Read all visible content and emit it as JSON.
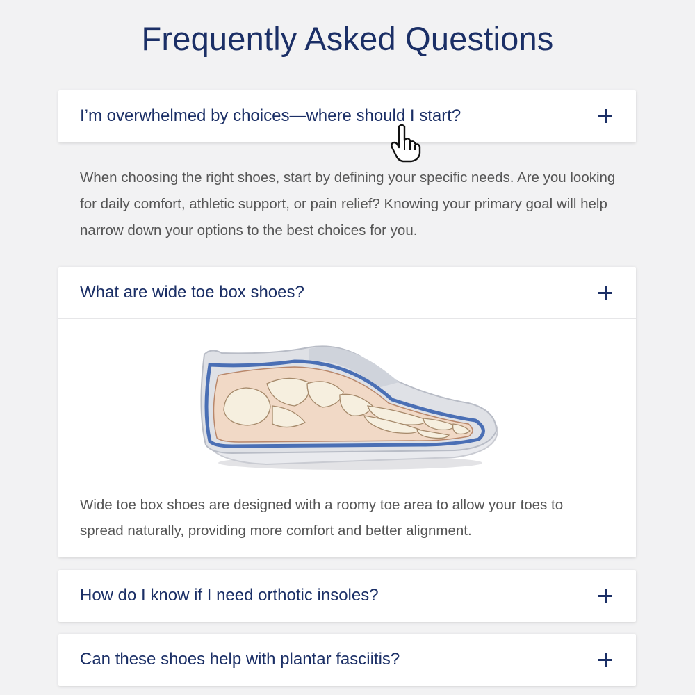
{
  "page": {
    "title": "Frequently Asked Questions"
  },
  "faq": [
    {
      "question": "I’m overwhelmed by choices—where should I start?",
      "answer": "When choosing the right shoes, start by defining your specific needs. Are you looking for daily comfort, athletic support, or pain relief? Knowing your primary goal will help narrow down your options to the best choices for you.",
      "toggle_icon": "plus-icon"
    },
    {
      "question": "What are wide toe box shoes?",
      "answer": "Wide toe box shoes are designed with a roomy toe area to allow your toes to spread naturally, providing more comfort and better alignment.",
      "image": "shoe-foot-skeleton-illustration",
      "toggle_icon": "plus-icon"
    },
    {
      "question": "How do I know if I need orthotic insoles?",
      "toggle_icon": "plus-icon"
    },
    {
      "question": "Can these shoes help with plantar fasciitis?",
      "toggle_icon": "plus-icon"
    }
  ],
  "cursor": "hand-pointer-icon",
  "colors": {
    "heading": "#1b2f66",
    "body_text": "#555555",
    "background": "#f2f2f3",
    "card": "#ffffff",
    "shoe_accent": "#4a6fb5"
  }
}
